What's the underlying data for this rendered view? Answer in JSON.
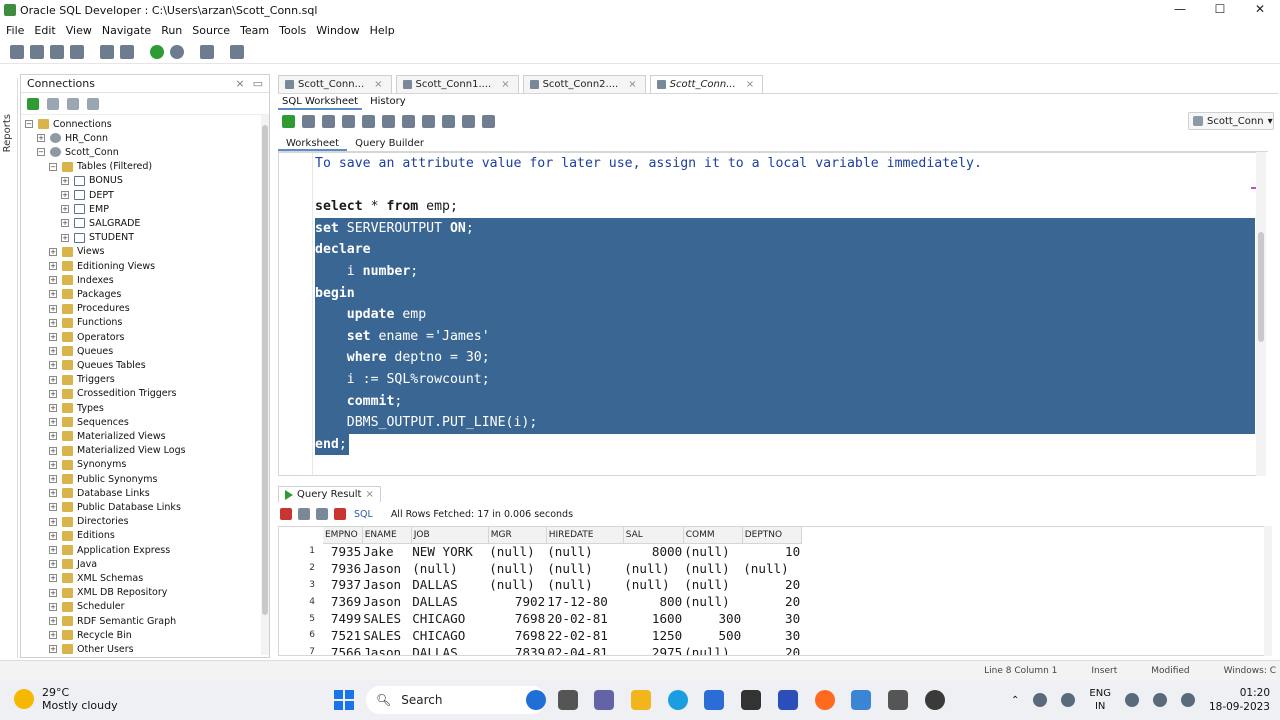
{
  "window": {
    "title": "Oracle SQL Developer : C:\\Users\\arzan\\Scott_Conn.sql",
    "minimize": "—",
    "maximize": "☐",
    "close": "✕"
  },
  "menu": [
    "File",
    "Edit",
    "View",
    "Navigate",
    "Run",
    "Source",
    "Team",
    "Tools",
    "Window",
    "Help"
  ],
  "rail": {
    "label": "Reports"
  },
  "connections": {
    "title": "Connections",
    "tree": [
      {
        "label": "Connections",
        "level": 0,
        "icon": "folder",
        "exp": "−"
      },
      {
        "label": "HR_Conn",
        "level": 1,
        "icon": "db",
        "exp": "+"
      },
      {
        "label": "Scott_Conn",
        "level": 1,
        "icon": "db",
        "exp": "−"
      },
      {
        "label": "Tables (Filtered)",
        "level": 2,
        "icon": "folder",
        "exp": "−"
      },
      {
        "label": "BONUS",
        "level": 3,
        "icon": "table",
        "exp": "+"
      },
      {
        "label": "DEPT",
        "level": 3,
        "icon": "table",
        "exp": "+"
      },
      {
        "label": "EMP",
        "level": 3,
        "icon": "table",
        "exp": "+"
      },
      {
        "label": "SALGRADE",
        "level": 3,
        "icon": "table",
        "exp": "+"
      },
      {
        "label": "STUDENT",
        "level": 3,
        "icon": "table",
        "exp": "+"
      },
      {
        "label": "Views",
        "level": 2,
        "icon": "folder",
        "exp": "+"
      },
      {
        "label": "Editioning Views",
        "level": 2,
        "icon": "folder",
        "exp": "+"
      },
      {
        "label": "Indexes",
        "level": 2,
        "icon": "folder",
        "exp": "+"
      },
      {
        "label": "Packages",
        "level": 2,
        "icon": "folder",
        "exp": "+"
      },
      {
        "label": "Procedures",
        "level": 2,
        "icon": "folder",
        "exp": "+"
      },
      {
        "label": "Functions",
        "level": 2,
        "icon": "folder",
        "exp": "+"
      },
      {
        "label": "Operators",
        "level": 2,
        "icon": "folder",
        "exp": "+"
      },
      {
        "label": "Queues",
        "level": 2,
        "icon": "folder",
        "exp": "+"
      },
      {
        "label": "Queues Tables",
        "level": 2,
        "icon": "folder",
        "exp": "+"
      },
      {
        "label": "Triggers",
        "level": 2,
        "icon": "folder",
        "exp": "+"
      },
      {
        "label": "Crossedition Triggers",
        "level": 2,
        "icon": "folder",
        "exp": "+"
      },
      {
        "label": "Types",
        "level": 2,
        "icon": "folder",
        "exp": "+"
      },
      {
        "label": "Sequences",
        "level": 2,
        "icon": "folder",
        "exp": "+"
      },
      {
        "label": "Materialized Views",
        "level": 2,
        "icon": "folder",
        "exp": "+"
      },
      {
        "label": "Materialized View Logs",
        "level": 2,
        "icon": "folder",
        "exp": "+"
      },
      {
        "label": "Synonyms",
        "level": 2,
        "icon": "folder",
        "exp": "+"
      },
      {
        "label": "Public Synonyms",
        "level": 2,
        "icon": "folder",
        "exp": "+"
      },
      {
        "label": "Database Links",
        "level": 2,
        "icon": "folder",
        "exp": "+"
      },
      {
        "label": "Public Database Links",
        "level": 2,
        "icon": "folder",
        "exp": "+"
      },
      {
        "label": "Directories",
        "level": 2,
        "icon": "folder",
        "exp": "+"
      },
      {
        "label": "Editions",
        "level": 2,
        "icon": "folder",
        "exp": "+"
      },
      {
        "label": "Application Express",
        "level": 2,
        "icon": "folder",
        "exp": "+"
      },
      {
        "label": "Java",
        "level": 2,
        "icon": "folder",
        "exp": "+"
      },
      {
        "label": "XML Schemas",
        "level": 2,
        "icon": "folder",
        "exp": "+"
      },
      {
        "label": "XML DB Repository",
        "level": 2,
        "icon": "folder",
        "exp": "+"
      },
      {
        "label": "Scheduler",
        "level": 2,
        "icon": "folder",
        "exp": "+"
      },
      {
        "label": "RDF Semantic Graph",
        "level": 2,
        "icon": "folder",
        "exp": "+"
      },
      {
        "label": "Recycle Bin",
        "level": 2,
        "icon": "folder",
        "exp": "+"
      },
      {
        "label": "Other Users",
        "level": 2,
        "icon": "folder",
        "exp": "+"
      }
    ]
  },
  "tabs": [
    {
      "label": "Scott_Conn...",
      "active": false
    },
    {
      "label": "Scott_Conn1....",
      "active": false
    },
    {
      "label": "Scott_Conn2....",
      "active": false
    },
    {
      "label": "Scott_Conn...",
      "active": true
    }
  ],
  "subtabs": {
    "sql_worksheet": "SQL Worksheet",
    "history": "History"
  },
  "connection_select": "Scott_Conn",
  "worksheet_tabs": {
    "worksheet": "Worksheet",
    "query_builder": "Query Builder"
  },
  "code_lines": [
    {
      "text": "To save an attribute value for later use, assign it to a local variable immediately.",
      "cls": "comment",
      "sel": false
    },
    {
      "text": "",
      "sel": false
    },
    {
      "text": "select * from emp;",
      "sel": false,
      "kw": [
        "select",
        "from"
      ]
    },
    {
      "text": "set SERVEROUTPUT ON;",
      "sel": true,
      "kw": [
        "set",
        "ON"
      ]
    },
    {
      "text": "declare",
      "sel": true,
      "kw": [
        "declare"
      ]
    },
    {
      "text": "    i number;",
      "sel": true,
      "kw": [
        "number"
      ]
    },
    {
      "text": "begin",
      "sel": true,
      "kw": [
        "begin"
      ]
    },
    {
      "text": "    update emp",
      "sel": true,
      "kw": [
        "update"
      ]
    },
    {
      "text": "    set ename ='James'",
      "sel": true,
      "kw": [
        "set"
      ]
    },
    {
      "text": "    where deptno = 30;",
      "sel": true,
      "kw": [
        "where"
      ]
    },
    {
      "text": "    i := SQL%rowcount;",
      "sel": true,
      "kw": [
        "SQL"
      ]
    },
    {
      "text": "    commit;",
      "sel": true,
      "kw": [
        "commit"
      ]
    },
    {
      "text": "    DBMS_OUTPUT.PUT_LINE(i);",
      "sel": true,
      "kw": []
    },
    {
      "text": "end;",
      "sel": true,
      "last": true,
      "kw": [
        "end"
      ]
    }
  ],
  "query_result": {
    "tab_label": "Query Result",
    "sql_label": "SQL",
    "status": "All Rows Fetched: 17 in 0.006 seconds",
    "columns": [
      "EMPNO",
      "ENAME",
      "JOB",
      "MGR",
      "HIREDATE",
      "SAL",
      "COMM",
      "DEPTNO"
    ],
    "rows": [
      [
        "1",
        "7935",
        "Jake",
        "NEW YORK",
        "(null)",
        "(null)",
        "8000",
        "(null)",
        "10"
      ],
      [
        "2",
        "7936",
        "Jason",
        "(null)",
        "(null)",
        "(null)",
        "(null)",
        "(null)",
        "(null)"
      ],
      [
        "3",
        "7937",
        "Jason",
        "DALLAS",
        "(null)",
        "(null)",
        "(null)",
        "(null)",
        "20"
      ],
      [
        "4",
        "7369",
        "Jason",
        "DALLAS",
        "7902",
        "17-12-80",
        "800",
        "(null)",
        "20"
      ],
      [
        "5",
        "7499",
        "SALES",
        "CHICAGO",
        "7698",
        "20-02-81",
        "1600",
        "300",
        "30"
      ],
      [
        "6",
        "7521",
        "SALES",
        "CHICAGO",
        "7698",
        "22-02-81",
        "1250",
        "500",
        "30"
      ],
      [
        "7",
        "7566",
        "Jason",
        "DALLAS",
        "7839",
        "02-04-81",
        "2975",
        "(null)",
        "20"
      ]
    ]
  },
  "statusbar": {
    "position": "Line 8 Column 1",
    "mode": "Insert",
    "modified": "Modified",
    "os": "Windows: C"
  },
  "taskbar": {
    "temp": "29°C",
    "weather": "Mostly cloudy",
    "search": "Search",
    "lang1": "ENG",
    "lang2": "IN",
    "time": "01:20",
    "date": "18-09-2023"
  },
  "colors": {
    "selection": "#3a6694",
    "comment": "#1d3f9e",
    "accent": "#5b8dc9"
  }
}
